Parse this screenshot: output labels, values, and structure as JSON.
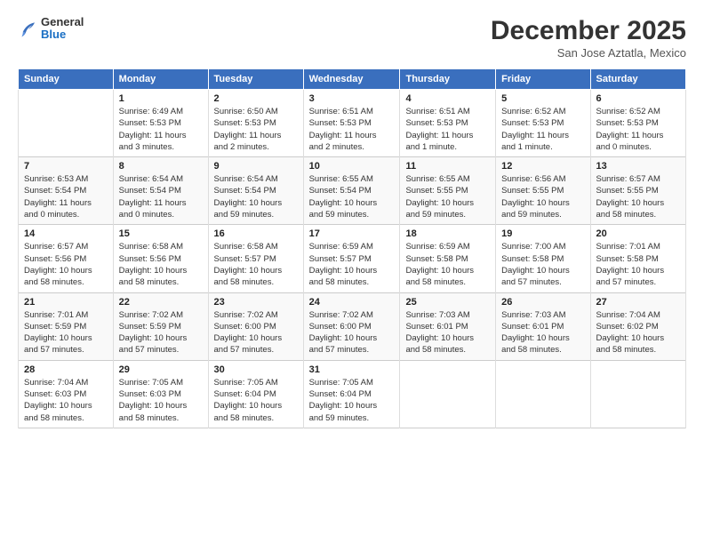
{
  "header": {
    "logo_general": "General",
    "logo_blue": "Blue",
    "title": "December 2025",
    "subtitle": "San Jose Aztatla, Mexico"
  },
  "calendar": {
    "days_of_week": [
      "Sunday",
      "Monday",
      "Tuesday",
      "Wednesday",
      "Thursday",
      "Friday",
      "Saturday"
    ],
    "weeks": [
      [
        {
          "day": "",
          "info": ""
        },
        {
          "day": "1",
          "info": "Sunrise: 6:49 AM\nSunset: 5:53 PM\nDaylight: 11 hours\nand 3 minutes."
        },
        {
          "day": "2",
          "info": "Sunrise: 6:50 AM\nSunset: 5:53 PM\nDaylight: 11 hours\nand 2 minutes."
        },
        {
          "day": "3",
          "info": "Sunrise: 6:51 AM\nSunset: 5:53 PM\nDaylight: 11 hours\nand 2 minutes."
        },
        {
          "day": "4",
          "info": "Sunrise: 6:51 AM\nSunset: 5:53 PM\nDaylight: 11 hours\nand 1 minute."
        },
        {
          "day": "5",
          "info": "Sunrise: 6:52 AM\nSunset: 5:53 PM\nDaylight: 11 hours\nand 1 minute."
        },
        {
          "day": "6",
          "info": "Sunrise: 6:52 AM\nSunset: 5:53 PM\nDaylight: 11 hours\nand 0 minutes."
        }
      ],
      [
        {
          "day": "7",
          "info": "Sunrise: 6:53 AM\nSunset: 5:54 PM\nDaylight: 11 hours\nand 0 minutes."
        },
        {
          "day": "8",
          "info": "Sunrise: 6:54 AM\nSunset: 5:54 PM\nDaylight: 11 hours\nand 0 minutes."
        },
        {
          "day": "9",
          "info": "Sunrise: 6:54 AM\nSunset: 5:54 PM\nDaylight: 10 hours\nand 59 minutes."
        },
        {
          "day": "10",
          "info": "Sunrise: 6:55 AM\nSunset: 5:54 PM\nDaylight: 10 hours\nand 59 minutes."
        },
        {
          "day": "11",
          "info": "Sunrise: 6:55 AM\nSunset: 5:55 PM\nDaylight: 10 hours\nand 59 minutes."
        },
        {
          "day": "12",
          "info": "Sunrise: 6:56 AM\nSunset: 5:55 PM\nDaylight: 10 hours\nand 59 minutes."
        },
        {
          "day": "13",
          "info": "Sunrise: 6:57 AM\nSunset: 5:55 PM\nDaylight: 10 hours\nand 58 minutes."
        }
      ],
      [
        {
          "day": "14",
          "info": "Sunrise: 6:57 AM\nSunset: 5:56 PM\nDaylight: 10 hours\nand 58 minutes."
        },
        {
          "day": "15",
          "info": "Sunrise: 6:58 AM\nSunset: 5:56 PM\nDaylight: 10 hours\nand 58 minutes."
        },
        {
          "day": "16",
          "info": "Sunrise: 6:58 AM\nSunset: 5:57 PM\nDaylight: 10 hours\nand 58 minutes."
        },
        {
          "day": "17",
          "info": "Sunrise: 6:59 AM\nSunset: 5:57 PM\nDaylight: 10 hours\nand 58 minutes."
        },
        {
          "day": "18",
          "info": "Sunrise: 6:59 AM\nSunset: 5:58 PM\nDaylight: 10 hours\nand 58 minutes."
        },
        {
          "day": "19",
          "info": "Sunrise: 7:00 AM\nSunset: 5:58 PM\nDaylight: 10 hours\nand 57 minutes."
        },
        {
          "day": "20",
          "info": "Sunrise: 7:01 AM\nSunset: 5:58 PM\nDaylight: 10 hours\nand 57 minutes."
        }
      ],
      [
        {
          "day": "21",
          "info": "Sunrise: 7:01 AM\nSunset: 5:59 PM\nDaylight: 10 hours\nand 57 minutes."
        },
        {
          "day": "22",
          "info": "Sunrise: 7:02 AM\nSunset: 5:59 PM\nDaylight: 10 hours\nand 57 minutes."
        },
        {
          "day": "23",
          "info": "Sunrise: 7:02 AM\nSunset: 6:00 PM\nDaylight: 10 hours\nand 57 minutes."
        },
        {
          "day": "24",
          "info": "Sunrise: 7:02 AM\nSunset: 6:00 PM\nDaylight: 10 hours\nand 57 minutes."
        },
        {
          "day": "25",
          "info": "Sunrise: 7:03 AM\nSunset: 6:01 PM\nDaylight: 10 hours\nand 58 minutes."
        },
        {
          "day": "26",
          "info": "Sunrise: 7:03 AM\nSunset: 6:01 PM\nDaylight: 10 hours\nand 58 minutes."
        },
        {
          "day": "27",
          "info": "Sunrise: 7:04 AM\nSunset: 6:02 PM\nDaylight: 10 hours\nand 58 minutes."
        }
      ],
      [
        {
          "day": "28",
          "info": "Sunrise: 7:04 AM\nSunset: 6:03 PM\nDaylight: 10 hours\nand 58 minutes."
        },
        {
          "day": "29",
          "info": "Sunrise: 7:05 AM\nSunset: 6:03 PM\nDaylight: 10 hours\nand 58 minutes."
        },
        {
          "day": "30",
          "info": "Sunrise: 7:05 AM\nSunset: 6:04 PM\nDaylight: 10 hours\nand 58 minutes."
        },
        {
          "day": "31",
          "info": "Sunrise: 7:05 AM\nSunset: 6:04 PM\nDaylight: 10 hours\nand 59 minutes."
        },
        {
          "day": "",
          "info": ""
        },
        {
          "day": "",
          "info": ""
        },
        {
          "day": "",
          "info": ""
        }
      ]
    ]
  }
}
